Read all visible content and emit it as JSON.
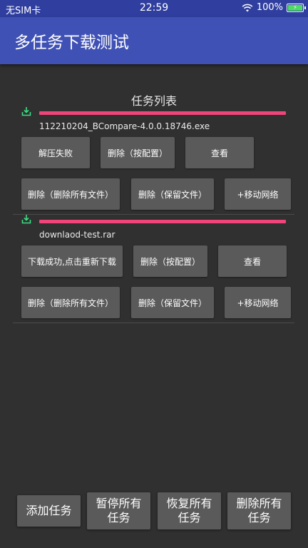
{
  "status_bar": {
    "carrier": "无SIM卡",
    "time": "22:59",
    "battery_pct": "100%"
  },
  "app_bar": {
    "title": "多任务下载测试"
  },
  "list": {
    "title": "任务列表",
    "tasks": [
      {
        "filename": "112210204_BCompare-4.0.0.18746.exe",
        "progress": 1.0,
        "buttons": {
          "status": "解压失败",
          "delete_config": "删除（按配置）",
          "view": "查看",
          "delete_all": "删除（删除所有文件）",
          "delete_keep": "删除（保留文件）",
          "mobile": "+移动网络"
        }
      },
      {
        "filename": "downlaod-test.rar",
        "progress": 1.0,
        "buttons": {
          "status": "下载成功,点击重新下载",
          "delete_config": "删除（按配置）",
          "view": "查看",
          "delete_all": "删除（删除所有文件）",
          "delete_keep": "删除（保留文件）",
          "mobile": "+移动网络"
        }
      }
    ]
  },
  "bottom": {
    "add": "添加任务",
    "pause_all_1": "暂停所有",
    "pause_all_2": "任务",
    "resume_all_1": "恢复所有",
    "resume_all_2": "任务",
    "delete_all_1": "删除所有",
    "delete_all_2": "任务"
  },
  "colors": {
    "status_bar": "#303F9F",
    "app_bar": "#3F51B5",
    "progress": "#F0457A",
    "icon": "#3DDC84",
    "background": "#303030"
  }
}
